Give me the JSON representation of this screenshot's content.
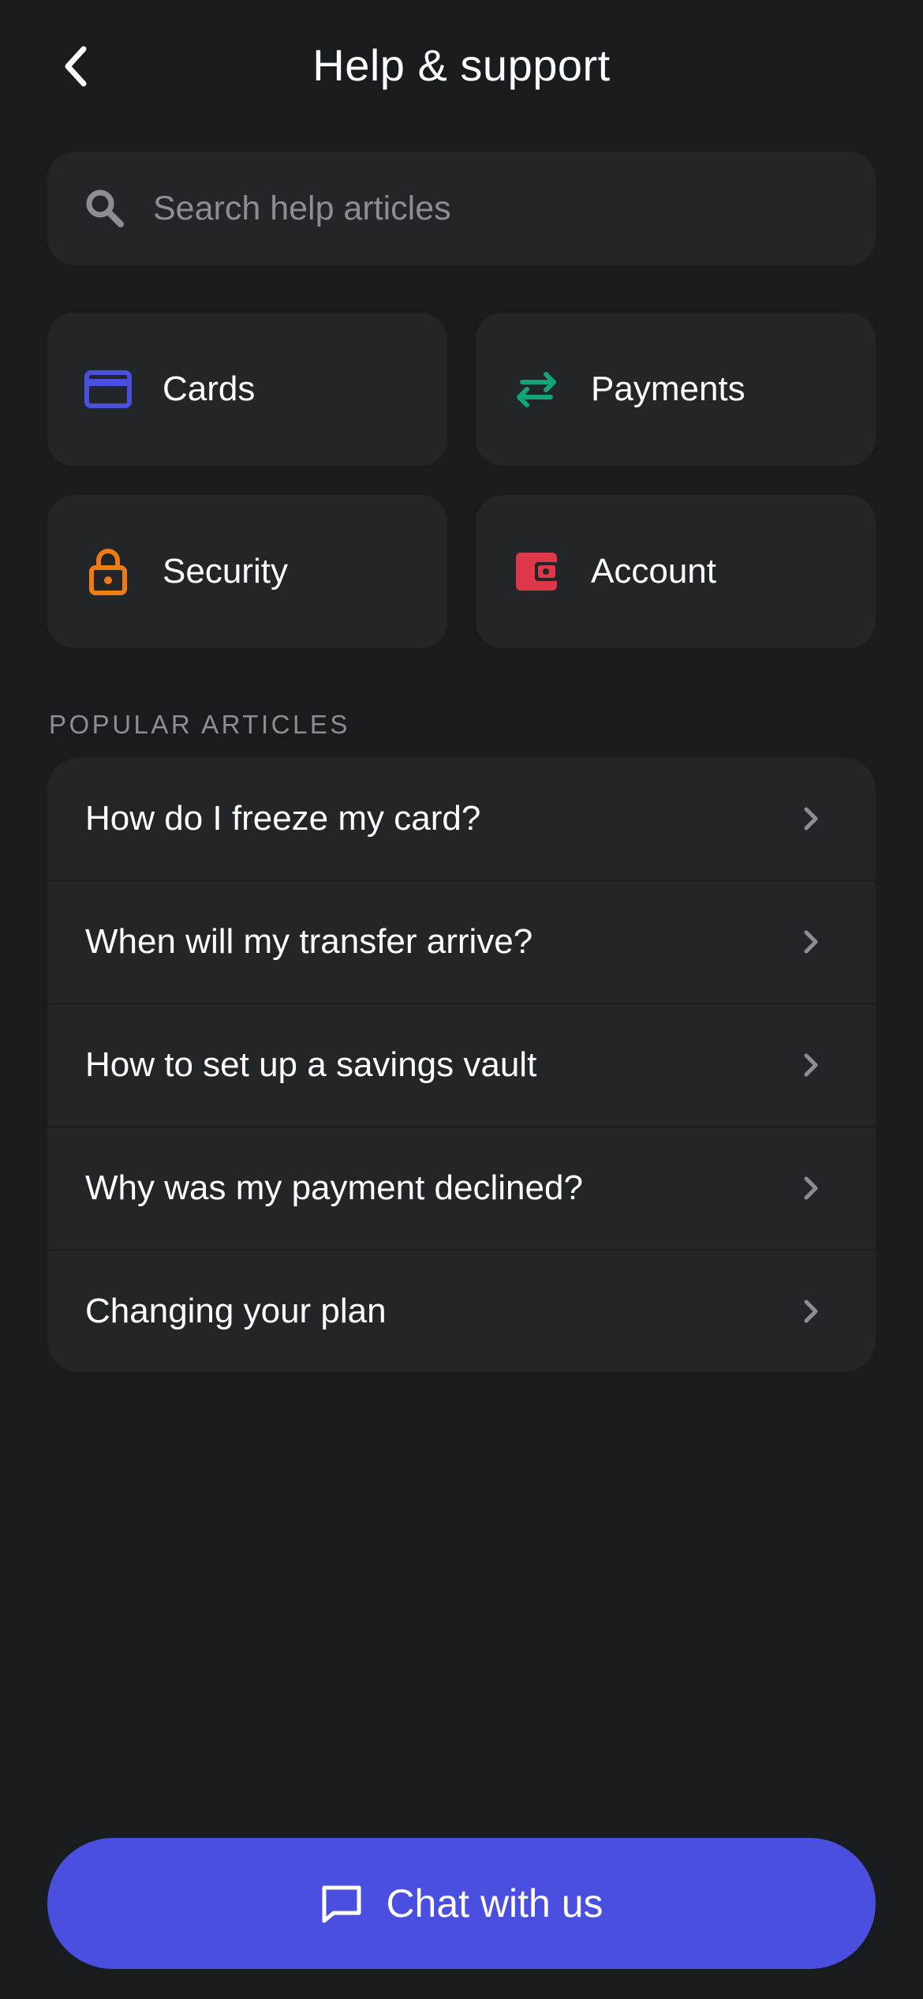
{
  "header": {
    "title": "Help & support",
    "back_icon": "chevron-left-icon"
  },
  "search": {
    "placeholder": "Search help articles",
    "value": "",
    "icon": "search-icon"
  },
  "categories": [
    {
      "label": "Cards",
      "icon": "credit-card-icon",
      "color": "#4a4fe0"
    },
    {
      "label": "Payments",
      "icon": "transfer-arrows-icon",
      "color": "#12a37a"
    },
    {
      "label": "Security",
      "icon": "padlock-icon",
      "color": "#ef7c12"
    },
    {
      "label": "Account",
      "icon": "wallet-icon",
      "color": "#e0384b"
    }
  ],
  "popular": {
    "section_title": "POPULAR ARTICLES",
    "articles": [
      "How do I freeze my card?",
      "When will my transfer arrive?",
      "How to set up a savings vault",
      "Why was my payment declined?",
      "Changing your plan"
    ]
  },
  "chat": {
    "label": "Chat with us",
    "icon": "chat-bubble-icon"
  },
  "colors": {
    "background": "#191c1f",
    "surface": "#232629",
    "accent": "#4a4fe0",
    "muted_text": "#8b8f95"
  }
}
